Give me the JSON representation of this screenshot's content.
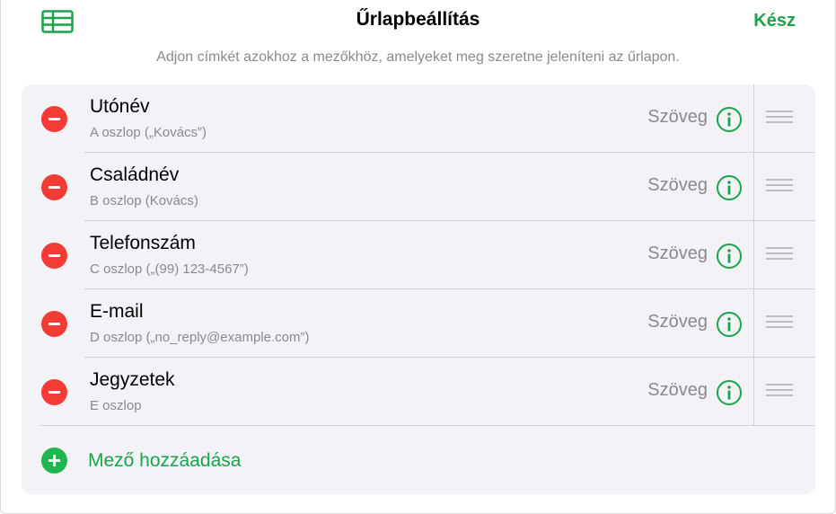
{
  "header": {
    "title": "Űrlapbeállítás",
    "done_label": "Kész",
    "left_icon": "table-icon"
  },
  "subtitle": "Adjon címkét azokhoz a mezőkhöz, amelyeket meg szeretne jeleníteni az űrlapon.",
  "fields": [
    {
      "name": "Utónév",
      "source": "A oszlop („Kovács”)",
      "type": "Szöveg"
    },
    {
      "name": "Családnév",
      "source": "B oszlop (Kovács)",
      "type": "Szöveg"
    },
    {
      "name": "Telefonszám",
      "source": "C oszlop („(99) 123-4567”)",
      "type": "Szöveg"
    },
    {
      "name": "E-mail",
      "source": "D oszlop („no_reply@example.com”)",
      "type": "Szöveg"
    },
    {
      "name": "Jegyzetek",
      "source": "E oszlop",
      "type": "Szöveg"
    }
  ],
  "add_field_label": "Mező hozzáadása",
  "colors": {
    "accent": "#1aa44a",
    "remove": "#f23b34",
    "add": "#1fb650",
    "card_bg": "#f2f2f7",
    "secondary_text": "#8a8a8e"
  }
}
